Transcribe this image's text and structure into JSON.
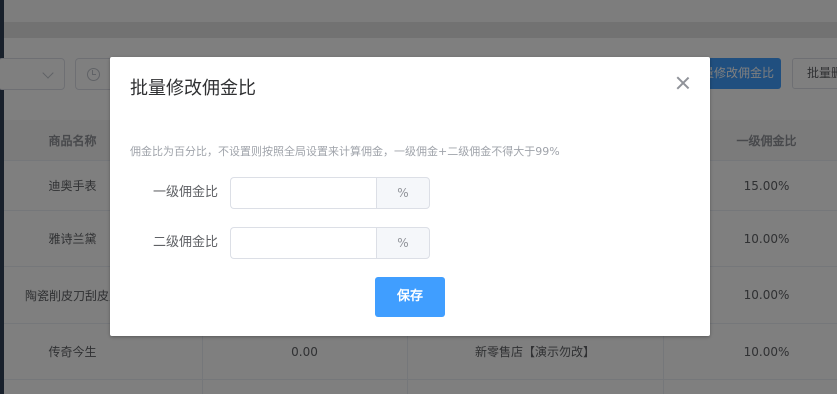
{
  "background": {
    "toolbar": {
      "batch_commission_button": "批量修改佣金比",
      "batch_other_button": "批量删除"
    },
    "table": {
      "columns": [
        "商品名称",
        "",
        "",
        "一级佣金比"
      ],
      "rows": [
        [
          "迪奥手表",
          "",
          "",
          "15.00%"
        ],
        [
          "雅诗兰黛",
          "",
          "",
          "10.00%"
        ],
        [
          "陶瓷削皮刀刮皮刀瓜果",
          "",
          "",
          "10.00%"
        ],
        [
          "传奇今生",
          "0.00",
          "新零售店【演示勿改】",
          "10.00%"
        ]
      ]
    }
  },
  "dialog": {
    "title": "批量修改佣金比",
    "hint": "佣金比为百分比，不设置则按照全局设置来计算佣金，一级佣金+二级佣金不得大于99%",
    "fields": [
      {
        "label": "一级佣金比",
        "value": "",
        "suffix": "%"
      },
      {
        "label": "二级佣金比",
        "value": "",
        "suffix": "%"
      }
    ],
    "save_label": "保存"
  }
}
